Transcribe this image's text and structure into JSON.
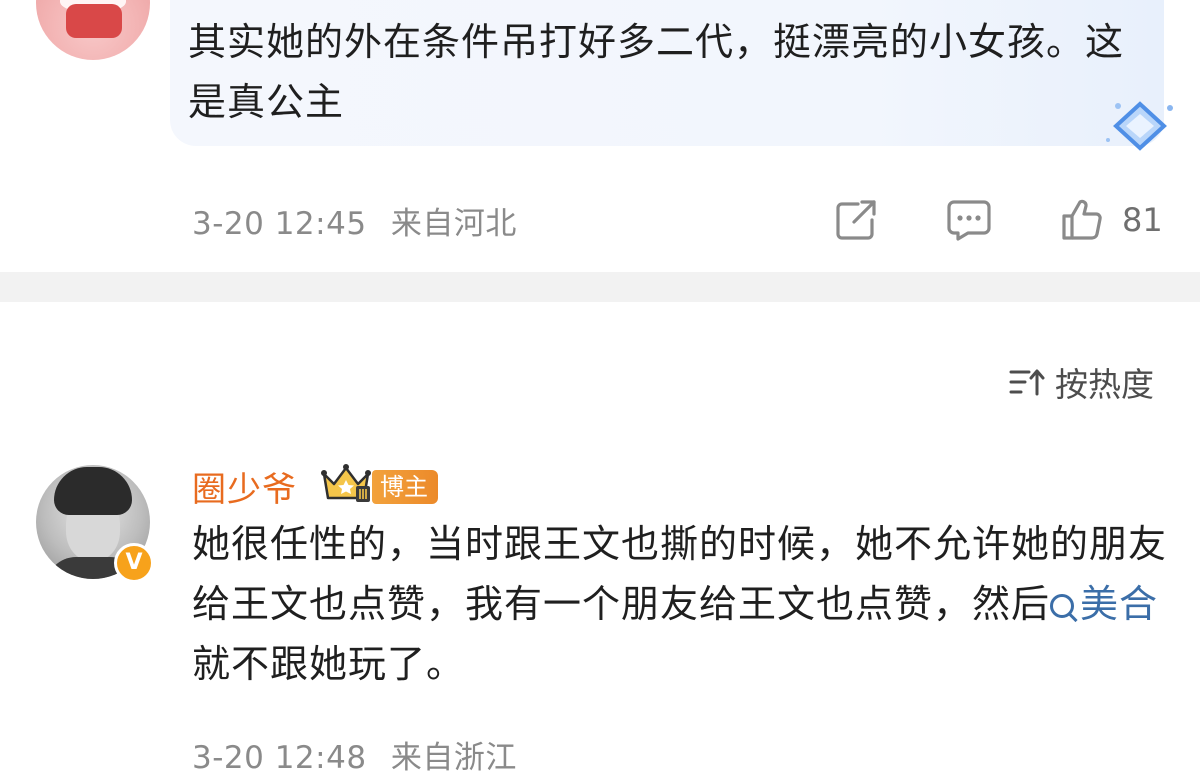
{
  "comments": [
    {
      "text": "其实她的外在条件吊打好多二代，挺漂亮的小女孩。这是真公主",
      "time": "3-20 12:45",
      "location": "来自河北",
      "likes": "81"
    },
    {
      "user": {
        "name": "圈少爷",
        "role_badge": "博主",
        "verified_mark": "V"
      },
      "text_before_topic": "她很任性的，当时跟王文也撕的时候，她不允许她的朋友给王文也点赞，我有一个朋友给王文也点赞，然后",
      "topic": "美合",
      "text_after_topic": " 就不跟她玩了。",
      "time": "3-20 12:48",
      "location": "来自浙江"
    }
  ],
  "sort": {
    "label": "按热度"
  },
  "colors": {
    "username": "#e86b1f",
    "topic_link": "#3b6ea8",
    "meta_text": "#8a8a8a",
    "divider": "#f2f2f2",
    "verified_badge": "#f7a21b"
  },
  "icons": [
    "share-icon",
    "comment-icon",
    "like-icon",
    "sort-icon",
    "search-icon",
    "crown-icon",
    "gem-icon"
  ]
}
